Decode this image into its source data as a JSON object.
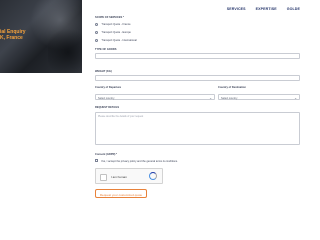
{
  "nav": [
    "SERVICES",
    "EXPERTISE",
    "GOLDE"
  ],
  "hero": {
    "line1": "ial Enquiry",
    "line2": "K, France"
  },
  "form": {
    "scope_label": "SCOPE OF SERVICES *",
    "scope_options": [
      "Transport Quote - France",
      "Transport Quote - Europe",
      "Transport Quote - International"
    ],
    "goods_label": "TYPE OF GOODS",
    "weight_label": "WEIGHT (KG)",
    "origin_label": "Country of Departure",
    "origin_value": "Select country",
    "dest_label": "Country of Destination",
    "dest_value": "Select country",
    "request_label": "REQUEST DETAILS",
    "request_placeholder": "Please describe the details of your request",
    "consent_label": "Consent (GDPR) *",
    "consent_text": "Yes, I accept the privacy policy and the general terms & conditions.",
    "captcha_text": "I am human",
    "submit_label": "Request your customized quote"
  },
  "colors": {
    "accent": "#e8823a",
    "nav": "#24346a",
    "hero_text": "#f6a23c"
  }
}
